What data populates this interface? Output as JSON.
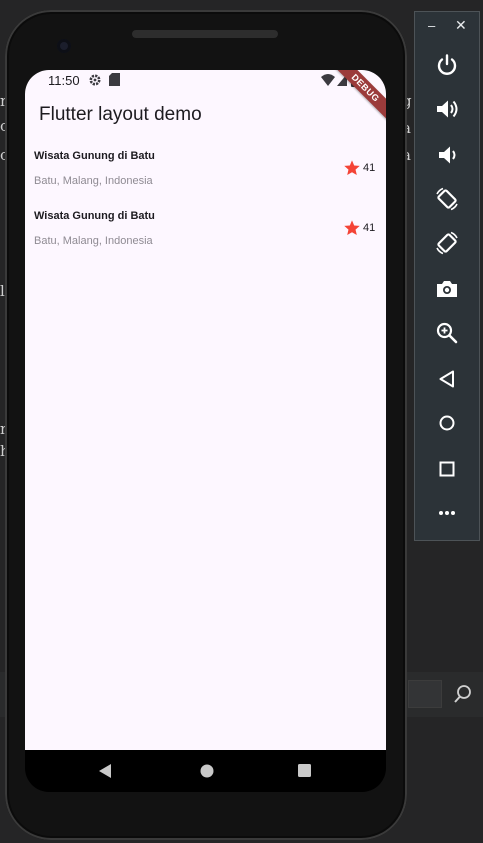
{
  "status": {
    "time": "11:50"
  },
  "debug_banner": "DEBUG",
  "appbar": {
    "title": "Flutter layout demo"
  },
  "items": [
    {
      "title": "Wisata Gunung di Batu",
      "subtitle": "Batu, Malang, Indonesia",
      "count": "41"
    },
    {
      "title": "Wisata Gunung di Batu",
      "subtitle": "Batu, Malang, Indonesia",
      "count": "41"
    }
  ],
  "toolbar": {
    "minimize_label": "–",
    "close_label": "✕",
    "buttons": [
      "power-icon",
      "volume-up-icon",
      "volume-down-icon",
      "rotate-left-icon",
      "rotate-right-icon",
      "camera-icon",
      "zoom-icon",
      "back-icon",
      "home-icon",
      "overview-icon",
      "more-icon"
    ]
  },
  "colors": {
    "screen_bg": "#fdf7ff",
    "star": "#f44336",
    "toolbar_bg": "#2c3338",
    "debug_banner": "#9b3b3b"
  }
}
